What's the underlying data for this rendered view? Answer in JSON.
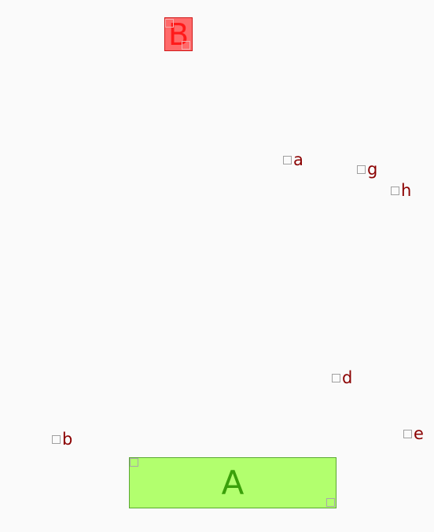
{
  "blocks": {
    "a": {
      "label": "A",
      "fill": "#b2ff6e",
      "text_color": "#3aa00a"
    },
    "b": {
      "label": "B",
      "fill": "#ff6a6a",
      "text_color": "#ff1a1a"
    }
  },
  "markers": {
    "a": "a",
    "g": "g",
    "h": "h",
    "d": "d",
    "b": "b",
    "e": "e"
  },
  "colors": {
    "background": "#fafafa",
    "marker_label": "#8b0000",
    "handle_border": "#a8a8a8"
  }
}
